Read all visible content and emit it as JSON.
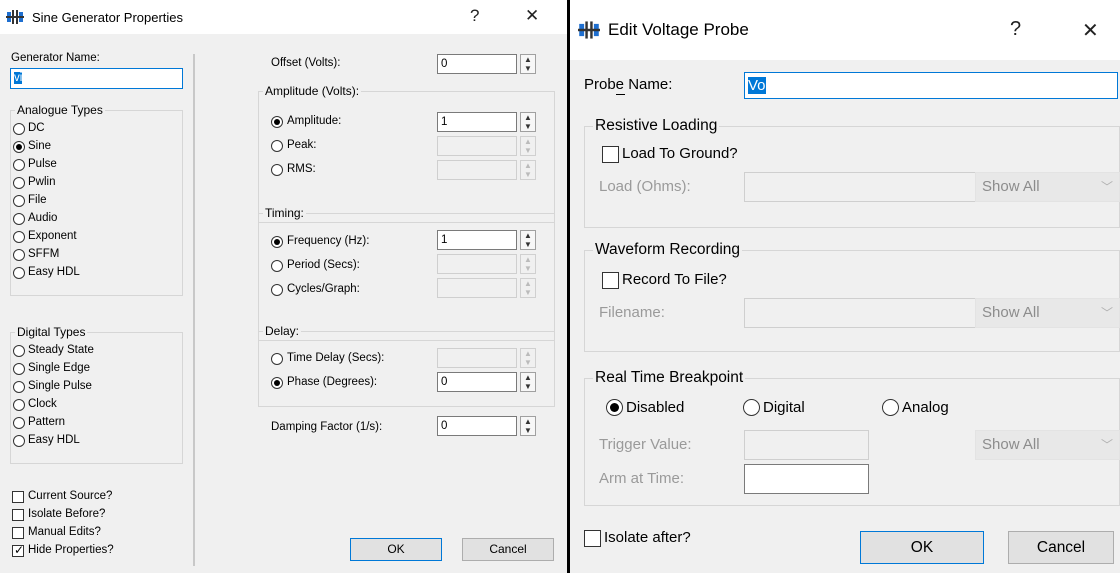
{
  "left_dialog": {
    "title": "Sine Generator Properties",
    "help": "?",
    "close": "✕",
    "generator_name_label": "Generator Name:",
    "generator_name_value": "vi",
    "analogue_types": {
      "legend": "Analogue Types",
      "options": [
        "DC",
        "Sine",
        "Pulse",
        "Pwlin",
        "File",
        "Audio",
        "Exponent",
        "SFFM",
        "Easy HDL"
      ],
      "selected": "Sine"
    },
    "digital_types": {
      "legend": "Digital Types",
      "options": [
        "Steady State",
        "Single Edge",
        "Single Pulse",
        "Clock",
        "Pattern",
        "Easy HDL"
      ]
    },
    "checkboxes": [
      {
        "label": "Current Source?",
        "checked": false
      },
      {
        "label": "Isolate Before?",
        "checked": false
      },
      {
        "label": "Manual Edits?",
        "checked": false
      },
      {
        "label": "Hide Properties?",
        "checked": true
      }
    ],
    "offset_label": "Offset (Volts):",
    "offset_value": "0",
    "amplitude": {
      "legend": "Amplitude (Volts):",
      "amplitude_label": "Amplitude:",
      "amplitude_value": "1",
      "peak_label": "Peak:",
      "rms_label": "RMS:"
    },
    "timing": {
      "legend": "Timing:",
      "frequency_label": "Frequency (Hz):",
      "frequency_value": "1",
      "period_label": "Period (Secs):",
      "cycles_label": "Cycles/Graph:"
    },
    "delay": {
      "legend": "Delay:",
      "time_delay_label": "Time Delay (Secs):",
      "phase_label": "Phase (Degrees):",
      "phase_value": "0"
    },
    "damping_label": "Damping Factor (1/s):",
    "damping_value": "0",
    "ok_label": "OK",
    "cancel_label": "Cancel"
  },
  "right_dialog": {
    "title": "Edit Voltage Probe",
    "help": "?",
    "close": "✕",
    "probe_name_label": "Probe Name:",
    "probe_name_value": "Vo",
    "resistive_loading": {
      "legend": "Resistive Loading",
      "load_to_ground": "Load To Ground?",
      "load_label": "Load (Ohms):",
      "show_all": "Show All"
    },
    "waveform_recording": {
      "legend": "Waveform Recording",
      "record_to_file": "Record To File?",
      "filename_label": "Filename:",
      "show_all": "Show All"
    },
    "breakpoint": {
      "legend": "Real Time Breakpoint",
      "options": [
        "Disabled",
        "Digital",
        "Analog"
      ],
      "selected": "Disabled",
      "trigger_label": "Trigger Value:",
      "arm_label": "Arm at Time:",
      "show_all": "Show All"
    },
    "isolate_after": "Isolate after?",
    "ok_label": "OK",
    "cancel_label": "Cancel"
  }
}
